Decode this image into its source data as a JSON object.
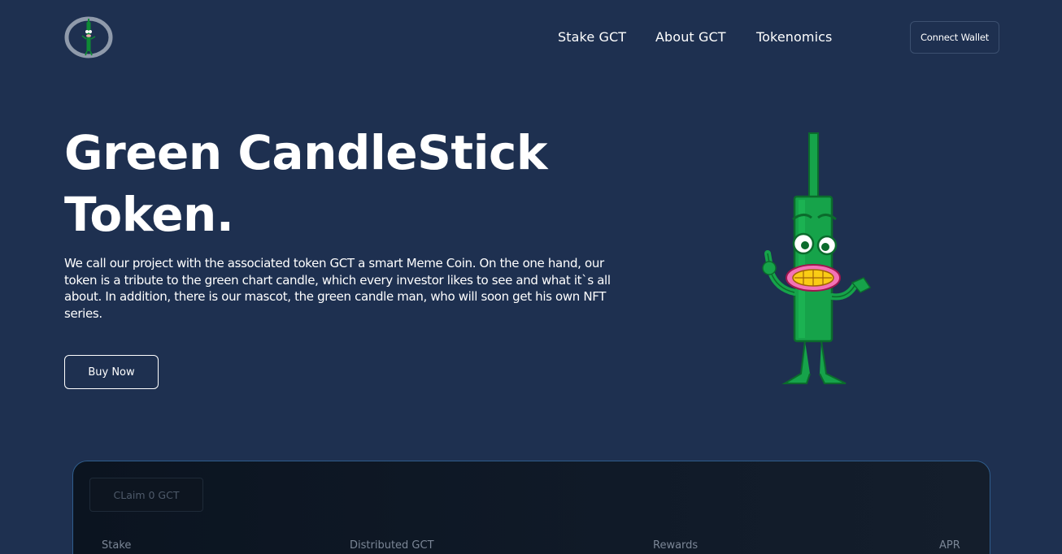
{
  "header": {
    "logo_icon": "green-candle-mascot-logo-icon",
    "nav": [
      {
        "label": "Stake GCT"
      },
      {
        "label": "About GCT"
      },
      {
        "label": "Tokenomics"
      }
    ],
    "connect_label": "Connect Wallet"
  },
  "hero": {
    "title_line1": "Green CandleStick",
    "title_line2": "Token.",
    "description": "We call our project with the associated token GCT a smart Meme Coin. On the one hand, our token is a tribute to the green chart candle, which every investor likes to see and what it`s all about. In addition, there is our mascot, the green candle man, who will soon get his own NFT series.",
    "buy_label": "Buy Now",
    "mascot_icon": "green-candle-man-mascot"
  },
  "stake_panel": {
    "claim_label": "CLaim 0 GCT",
    "columns": [
      "Stake",
      "Distributed GCT",
      "Rewards",
      "APR"
    ]
  },
  "colors": {
    "background": "#1e3050",
    "mascot_green": "#16a34a",
    "panel_border": "#2f5d8c",
    "panel_bg": "#0b1420"
  }
}
